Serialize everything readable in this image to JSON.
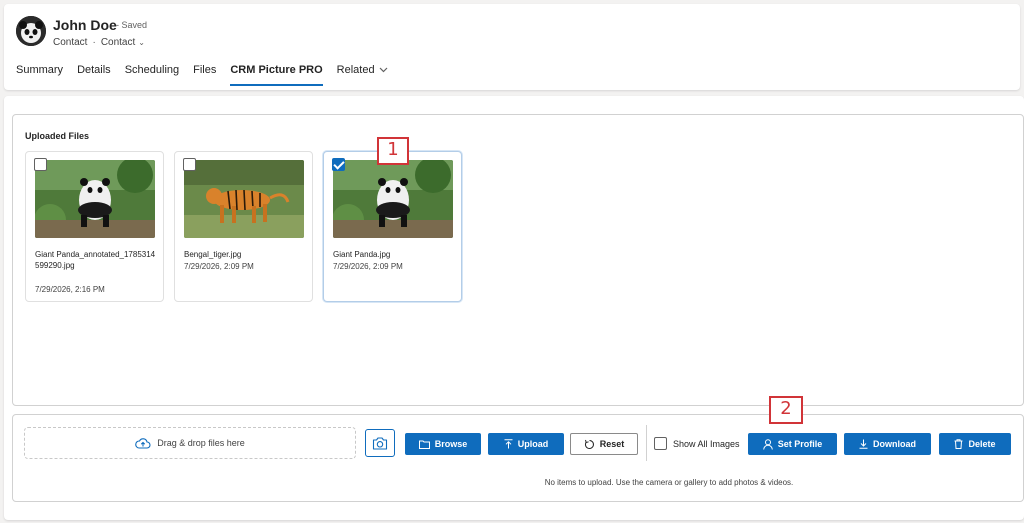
{
  "header": {
    "record_name": "John Doe",
    "saved_status": "- Saved",
    "entity_type": "Contact",
    "form_selector": "Contact",
    "tabs": [
      {
        "label": "Summary"
      },
      {
        "label": "Details"
      },
      {
        "label": "Scheduling"
      },
      {
        "label": "Files"
      },
      {
        "label": "CRM Picture PRO",
        "active": true
      },
      {
        "label": "Related"
      }
    ]
  },
  "uploaded": {
    "title": "Uploaded Files",
    "files": [
      {
        "name": "Giant Panda_annotated_1785314599290.jpg",
        "date": "7/29/2026, 2:16 PM",
        "checked": false,
        "image": "panda"
      },
      {
        "name": "Bengal_tiger.jpg",
        "date": "7/29/2026, 2:09 PM",
        "checked": false,
        "image": "tiger"
      },
      {
        "name": "Giant Panda.jpg",
        "date": "7/29/2026, 2:09 PM",
        "checked": true,
        "image": "panda"
      }
    ]
  },
  "annotations": {
    "marker_1": "1",
    "marker_2": "2",
    "color": "#d13438"
  },
  "actions": {
    "dropzone_text": "Drag & drop files here",
    "browse_label": "Browse",
    "upload_label": "Upload",
    "reset_label": "Reset",
    "show_all_label": "Show All Images",
    "set_profile_label": "Set Profile",
    "download_label": "Download",
    "delete_label": "Delete",
    "hint_text": "No items to upload. Use the camera or gallery to add photos & videos."
  },
  "colors": {
    "accent": "#0f6cbd",
    "background": "#f3f2f1"
  }
}
